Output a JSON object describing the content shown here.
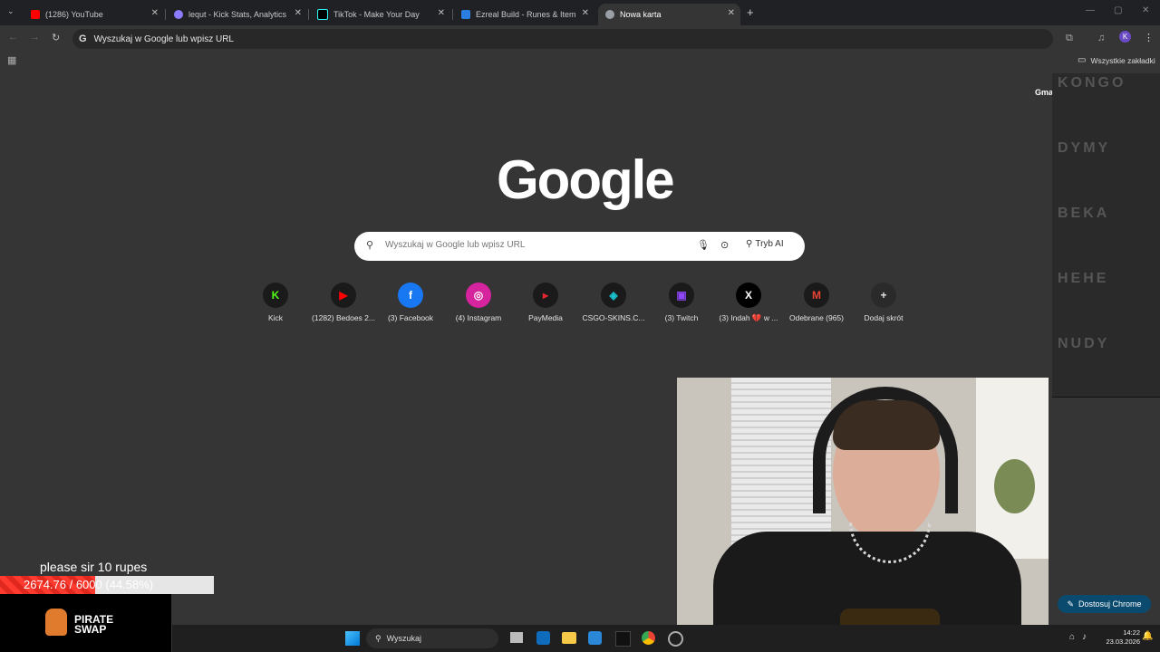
{
  "tabs": [
    {
      "title": "(1286) YouTube",
      "color": "#ff0000"
    },
    {
      "title": "lequt - Kick Stats, Analytics and",
      "color": "#8a7cff"
    },
    {
      "title": "TikTok - Make Your Day",
      "color": "#000000"
    },
    {
      "title": "Ezreal Build - Runes & Items Pa",
      "color": "#2a7de1"
    },
    {
      "title": "Nowa karta",
      "color": "#9aa0a6"
    }
  ],
  "omnibox": {
    "text": "Wyszukaj w Google lub wpisz URL"
  },
  "bookmarks": {
    "all_label": "Wszystkie zakładki"
  },
  "logo": "Google",
  "search": {
    "placeholder": "Wyszukaj w Google lub wpisz URL",
    "ai_label": "Tryb AI"
  },
  "shortcuts": [
    {
      "label": "Kick",
      "glyph": "K",
      "bg": "#1a1a1a",
      "fg": "#53fc18",
      "icon": "kick-icon"
    },
    {
      "label": "(1282) Bedoes 2...",
      "glyph": "▶",
      "bg": "#1a1a1a",
      "fg": "#ff0000",
      "icon": "youtube-icon"
    },
    {
      "label": "(3) Facebook",
      "glyph": "f",
      "bg": "#1877f2",
      "fg": "#ffffff",
      "icon": "facebook-icon"
    },
    {
      "label": "(4) Instagram",
      "glyph": "◎",
      "bg": "#d6249f",
      "fg": "#ffffff",
      "icon": "instagram-icon"
    },
    {
      "label": "PayMedia",
      "glyph": "▸",
      "bg": "#1a1a1a",
      "fg": "#e3262f",
      "icon": "paymedia-icon"
    },
    {
      "label": "CSGO-SKINS.C...",
      "glyph": "◈",
      "bg": "#1a1a1a",
      "fg": "#19c3d2",
      "icon": "csgo-skins-icon"
    },
    {
      "label": "(3) Twitch",
      "glyph": "▣",
      "bg": "#1a1a1a",
      "fg": "#9146ff",
      "icon": "twitch-icon"
    },
    {
      "label": "(3) Indah 💔 w ...",
      "glyph": "X",
      "bg": "#000000",
      "fg": "#ffffff",
      "icon": "x-icon"
    },
    {
      "label": "Odebrane (965)",
      "glyph": "M",
      "bg": "#1a1a1a",
      "fg": "#ea4335",
      "icon": "gmail-icon"
    },
    {
      "label": "Dodaj skrót",
      "glyph": "+",
      "bg": "#2a2a2a",
      "fg": "#e3e3e3",
      "icon": "add-icon"
    }
  ],
  "gmail_link": "Gmai",
  "memes": [
    "KONGO",
    "DYMY",
    "BEKA",
    "HEHE",
    "NUDY"
  ],
  "overlay": {
    "message": "please sir 10 rupes",
    "progress_text": "2674.76 / 6000 (44.58%)",
    "progress": 0.4458,
    "brand": "PIRATE SWAP"
  },
  "customize": {
    "label": "Dostosuj Chrome"
  },
  "taskbar": {
    "search_label": "Wyszukaj",
    "time": "14:22",
    "date": "23.03.2026"
  }
}
